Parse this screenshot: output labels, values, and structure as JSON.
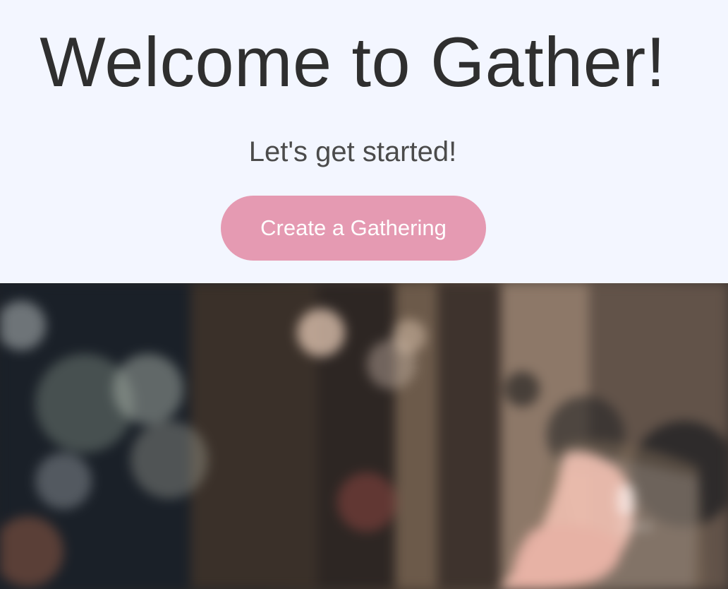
{
  "header": {
    "title": "Welcome to Gather!",
    "subtitle": "Let's get started!",
    "cta_label": "Create a Gathering"
  },
  "hero_image": {
    "semantic": "blurred-bar-photo-with-wine-glass"
  },
  "colors": {
    "background": "#f3f6ff",
    "title_text": "#2f2f2f",
    "subtitle_text": "#4b4b4b",
    "cta_background": "#e59ab2",
    "cta_text": "#ffffff"
  }
}
